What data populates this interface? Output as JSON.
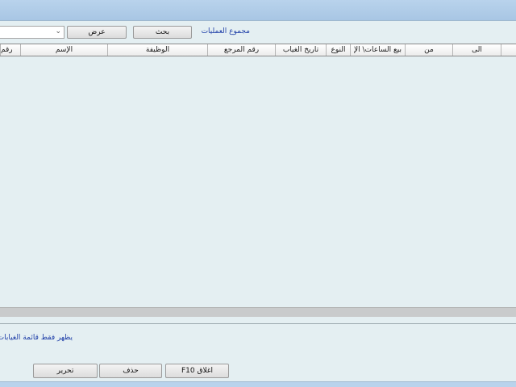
{
  "toolbar": {
    "ops_group_label": "مجموع العمليات",
    "search_label": "بحث",
    "view_label": "عرض",
    "combo_value": ""
  },
  "table": {
    "columns": [
      "",
      "الى",
      "من",
      "بيع الساعات\\ الإ",
      "النوع",
      "تاريخ الغياب",
      "رقم المرجع",
      "الوظيفة",
      "الإسم",
      "رقم"
    ],
    "rows": []
  },
  "note": {
    "text": "يظهر فقط قائمة الغيابات"
  },
  "actions": {
    "close_label": "F10 اغلاق",
    "delete_label": "حذف",
    "edit_label": "تحرير"
  }
}
